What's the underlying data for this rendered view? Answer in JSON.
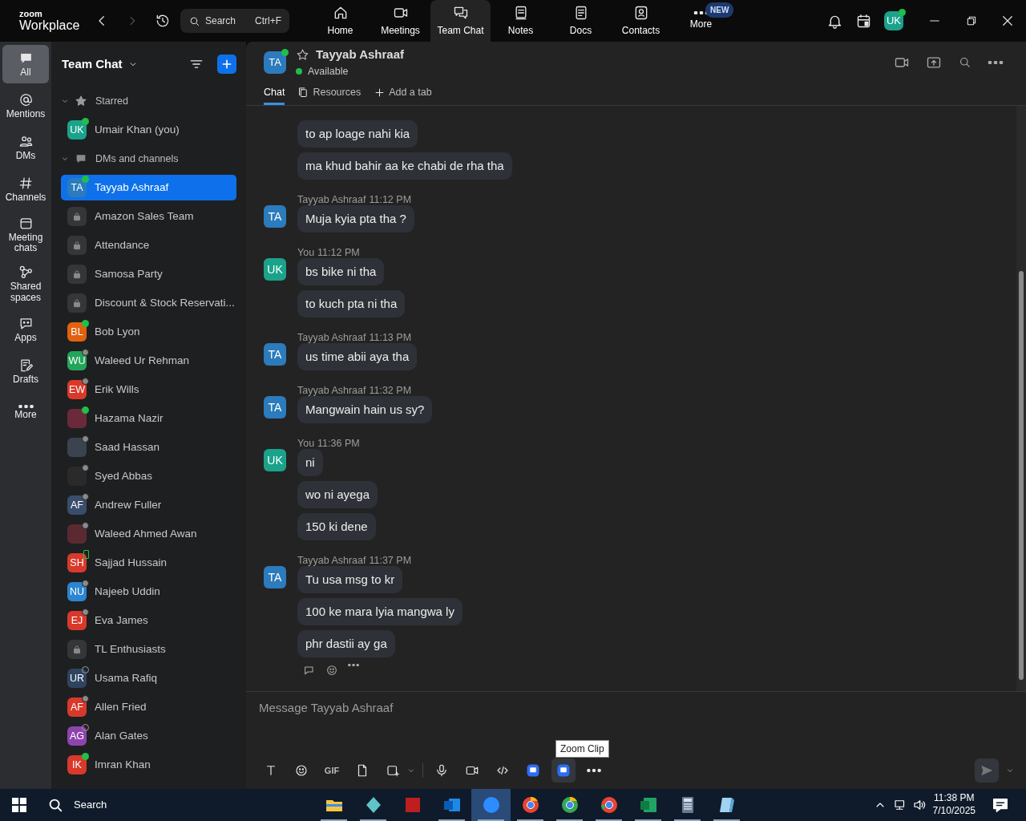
{
  "title_bar": {
    "brand_top": "zoom",
    "brand": "Workplace",
    "search": {
      "placeholder": "Search",
      "shortcut": "Ctrl+F"
    },
    "nav": [
      {
        "label": "Home",
        "selected": false
      },
      {
        "label": "Meetings",
        "selected": false
      },
      {
        "label": "Team Chat",
        "selected": true
      },
      {
        "label": "Notes",
        "selected": false
      },
      {
        "label": "Docs",
        "selected": false
      },
      {
        "label": "Contacts",
        "selected": false
      },
      {
        "label": "More",
        "selected": false,
        "badge": "NEW"
      }
    ],
    "avatar": {
      "initials": "UK",
      "color": "#1aa38a",
      "presence": {
        "kind": "online"
      }
    }
  },
  "rail": [
    {
      "label": "All",
      "selected": true
    },
    {
      "label": "Mentions",
      "selected": false
    },
    {
      "label": "DMs",
      "selected": false
    },
    {
      "label": "Channels",
      "selected": false
    },
    {
      "label": "Meeting chats",
      "selected": false
    },
    {
      "label": "Shared spaces",
      "selected": false
    },
    {
      "label": "Apps",
      "selected": false
    },
    {
      "label": "Drafts",
      "selected": false
    },
    {
      "label": "More",
      "selected": false
    }
  ],
  "chat_list": {
    "title": "Team Chat",
    "sections": [
      {
        "label": "Starred",
        "expanded": true,
        "items": [
          {
            "kind": "avatar",
            "name": "Umair Khan (you)",
            "initials": "UK",
            "color": "#1aa38a",
            "presence": {
              "kind": "online"
            },
            "selected": false
          }
        ]
      },
      {
        "label": "DMs and channels",
        "expanded": true,
        "items": [
          {
            "kind": "avatar",
            "name": "Tayyab Ashraaf",
            "initials": "TA",
            "color": "#2b7bbd",
            "presence": {
              "kind": "online"
            },
            "selected": true
          },
          {
            "kind": "channel",
            "name": "Amazon Sales Team",
            "selected": false
          },
          {
            "kind": "channel",
            "name": "Attendance",
            "selected": false
          },
          {
            "kind": "channel",
            "name": "Samosa Party",
            "selected": false
          },
          {
            "kind": "channel",
            "name": "Discount & Stock Reservati...",
            "selected": false
          },
          {
            "kind": "avatar",
            "name": "Bob Lyon",
            "initials": "BL",
            "color": "#e0620f",
            "presence": {
              "kind": "online"
            },
            "selected": false
          },
          {
            "kind": "avatar",
            "name": "Waleed Ur Rehman",
            "initials": "WU",
            "color": "#22a55a",
            "presence": {
              "kind": "away"
            },
            "selected": false
          },
          {
            "kind": "avatar",
            "name": "Erik Wills",
            "initials": "EW",
            "color": "#d8392b",
            "presence": {
              "kind": "away"
            },
            "selected": false
          },
          {
            "kind": "photo",
            "name": "Hazama Nazir",
            "color": "#6b2a3a",
            "presence": {
              "kind": "online"
            },
            "selected": false
          },
          {
            "kind": "photo",
            "name": "Saad Hassan",
            "color": "#3b4350",
            "presence": {
              "kind": "away"
            },
            "selected": false
          },
          {
            "kind": "photo",
            "name": "Syed Abbas",
            "color": "#2a2a2a",
            "presence": {
              "kind": "away"
            },
            "selected": false
          },
          {
            "kind": "avatar",
            "name": "Andrew Fuller",
            "initials": "AF",
            "color": "#3a4d6b",
            "presence": {
              "kind": "away"
            },
            "selected": false
          },
          {
            "kind": "photo",
            "name": "Waleed Ahmed Awan",
            "color": "#5a2a30",
            "presence": {
              "kind": "away"
            },
            "selected": false
          },
          {
            "kind": "avatar",
            "name": "Sajjad Hussain",
            "initials": "SH",
            "color": "#d8392b",
            "presence": {
              "kind": "mobile"
            },
            "selected": false
          },
          {
            "kind": "avatar",
            "name": "Najeeb Uddin",
            "initials": "NU",
            "color": "#2b85d0",
            "presence": {
              "kind": "away"
            },
            "selected": false
          },
          {
            "kind": "avatar",
            "name": "Eva James",
            "initials": "EJ",
            "color": "#d8392b",
            "presence": {
              "kind": "away"
            },
            "selected": false
          },
          {
            "kind": "channel",
            "name": "TL Enthusiasts",
            "selected": false
          },
          {
            "kind": "avatar",
            "name": "Usama Rafiq",
            "initials": "UR",
            "color": "#2f4460",
            "presence": {
              "kind": "offline"
            },
            "selected": false
          },
          {
            "kind": "avatar",
            "name": "Allen Fried",
            "initials": "AF",
            "color": "#d8392b",
            "presence": {
              "kind": "away"
            },
            "selected": false
          },
          {
            "kind": "avatar",
            "name": "Alan Gates",
            "initials": "AG",
            "color": "#8e44ad",
            "presence": {
              "kind": "offline"
            },
            "selected": false
          },
          {
            "kind": "avatar",
            "name": "Imran Khan",
            "initials": "IK",
            "color": "#d8392b",
            "presence": {
              "kind": "online"
            },
            "selected": false
          }
        ]
      }
    ]
  },
  "conversation": {
    "initials": "TA",
    "color": "#2b7bbd",
    "name": "Tayyab Ashraaf",
    "starred": false,
    "status": "Available",
    "presence": {
      "kind": "online"
    },
    "tabs": [
      {
        "label": "Chat",
        "selected": true
      },
      {
        "label": "Resources",
        "selected": false
      },
      {
        "label": "Add a tab",
        "selected": false
      }
    ],
    "groups": [
      {
        "messages": [
          "to ap loage nahi kia",
          "ma khud bahir aa ke chabi de rha tha"
        ]
      },
      {
        "sender": "Tayyab Ashraaf",
        "time": "11:12 PM",
        "initials": "TA",
        "color": "#2b7bbd",
        "messages": [
          "Muja kyia pta tha ?"
        ]
      },
      {
        "sender": "You",
        "time": "11:12 PM",
        "initials": "UK",
        "color": "#1aa38a",
        "messages": [
          "bs bike ni tha",
          "to kuch pta ni tha"
        ]
      },
      {
        "sender": "Tayyab Ashraaf",
        "time": "11:13 PM",
        "initials": "TA",
        "color": "#2b7bbd",
        "messages": [
          "us time abii aya tha"
        ]
      },
      {
        "sender": "Tayyab Ashraaf",
        "time": "11:32 PM",
        "initials": "TA",
        "color": "#2b7bbd",
        "messages": [
          "Mangwain hain us sy?"
        ]
      },
      {
        "sender": "You",
        "time": "11:36 PM",
        "initials": "UK",
        "color": "#1aa38a",
        "messages": [
          "ni",
          "wo ni ayega",
          "150 ki dene"
        ]
      },
      {
        "sender": "Tayyab Ashraaf",
        "time": "11:37 PM",
        "initials": "TA",
        "color": "#2b7bbd",
        "messages": [
          "Tu usa msg to kr",
          "100 ke mara lyia mangwa ly",
          "phr dastii ay ga"
        ]
      }
    ]
  },
  "composer": {
    "placeholder": "Message Tayyab Ashraaf",
    "gif": "GIF",
    "tooltip": "Zoom Clip"
  },
  "taskbar": {
    "search": "Search",
    "time": "11:38 PM",
    "date": "7/10/2025",
    "apps": [
      {
        "running": true,
        "selected": false
      },
      {
        "running": true,
        "selected": false
      },
      {
        "running": false,
        "selected": false
      },
      {
        "running": true,
        "selected": false
      },
      {
        "running": true,
        "selected": true
      },
      {
        "running": true,
        "selected": false
      },
      {
        "running": true,
        "selected": false
      },
      {
        "running": true,
        "selected": false
      },
      {
        "running": true,
        "selected": false
      },
      {
        "running": true,
        "selected": false
      },
      {
        "running": true,
        "selected": false
      }
    ]
  }
}
